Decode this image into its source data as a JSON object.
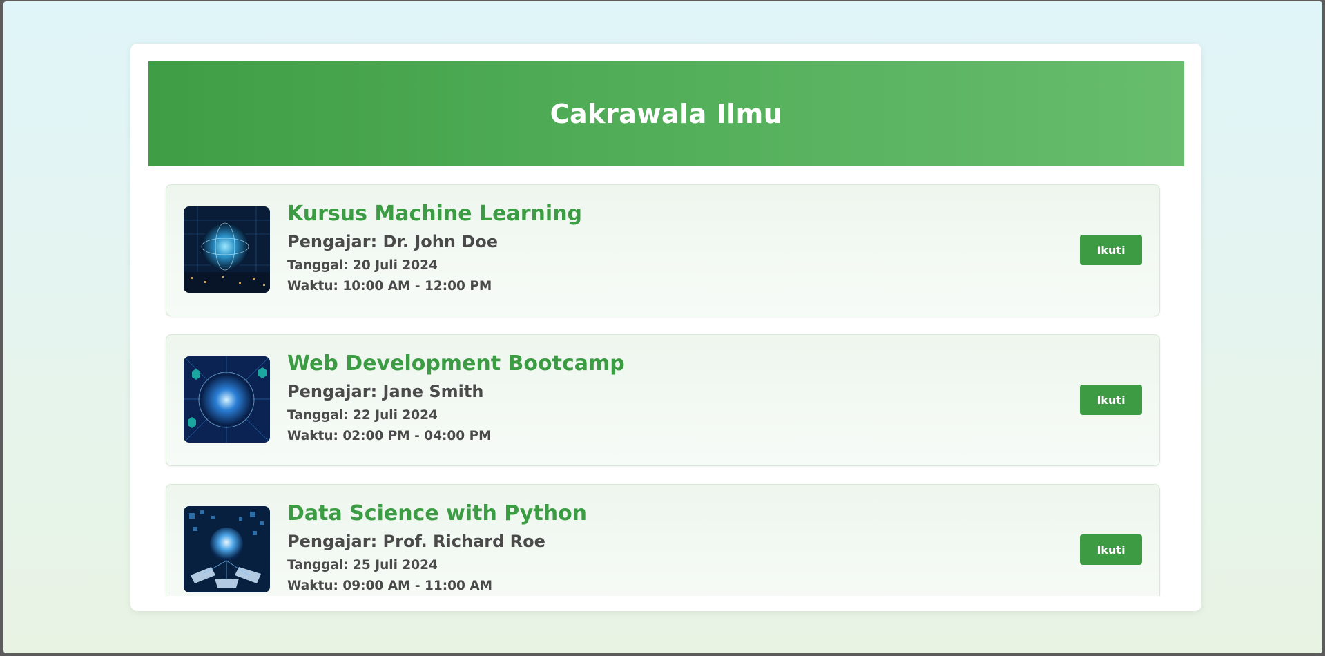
{
  "app": {
    "title": "Cakrawala Ilmu"
  },
  "colors": {
    "accent": "#3d9b44",
    "header_gradient_start": "#3f9e45",
    "header_gradient_end": "#67bd6c",
    "text": "#4a4a4a"
  },
  "courses": [
    {
      "title": "Kursus Machine Learning",
      "teacher": "Pengajar: Dr. John Doe",
      "date": "Tanggal: 20 Juli 2024",
      "time": "Waktu: 10:00 AM - 12:00 PM",
      "button_label": "Ikuti",
      "image_icon": "globe-network-icon"
    },
    {
      "title": "Web Development Bootcamp",
      "teacher": "Pengajar: Jane Smith",
      "date": "Tanggal: 22 Juli 2024",
      "time": "Waktu: 02:00 PM - 04:00 PM",
      "button_label": "Ikuti",
      "image_icon": "globe-network-icon"
    },
    {
      "title": "Data Science with Python",
      "teacher": "Pengajar: Prof. Richard Roe",
      "date": "Tanggal: 25 Juli 2024",
      "time": "Waktu: 09:00 AM - 11:00 AM",
      "button_label": "Ikuti",
      "image_icon": "globe-network-icon"
    }
  ]
}
